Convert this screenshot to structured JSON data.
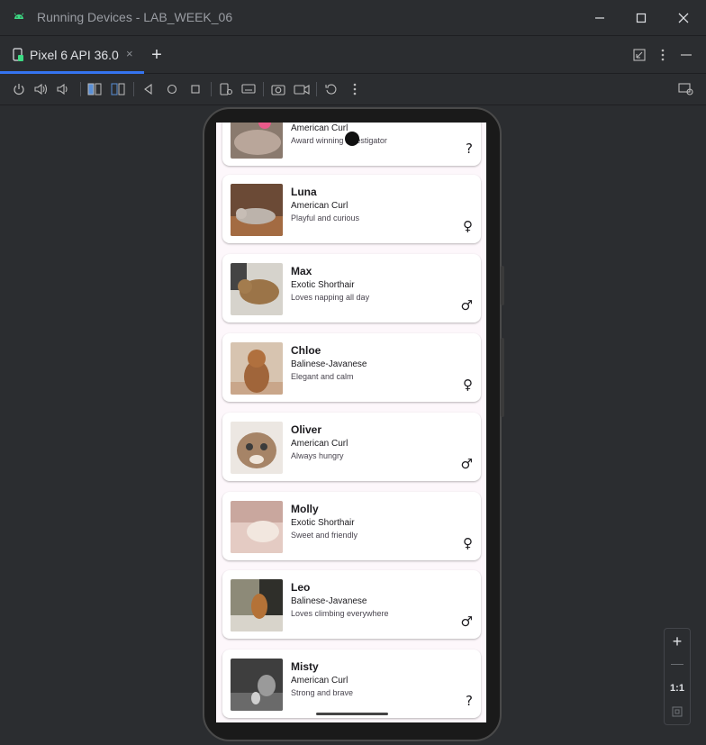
{
  "window": {
    "title": "Running Devices - LAB_WEEK_06"
  },
  "tab": {
    "label": "Pixel 6 API 36.0",
    "close": "×",
    "add": "+"
  },
  "zoom": {
    "plus": "+",
    "minus": "—",
    "one_to_one": "1:1"
  },
  "cats": [
    {
      "name": "",
      "breed": "American Curl",
      "desc": "Award winning investigator",
      "gender": "?"
    },
    {
      "name": "Luna",
      "breed": "American Curl",
      "desc": "Playful and curious",
      "gender": "♀"
    },
    {
      "name": "Max",
      "breed": "Exotic Shorthair",
      "desc": "Loves napping all day",
      "gender": "♂"
    },
    {
      "name": "Chloe",
      "breed": "Balinese-Javanese",
      "desc": "Elegant and calm",
      "gender": "♀"
    },
    {
      "name": "Oliver",
      "breed": "American Curl",
      "desc": "Always hungry",
      "gender": "♂"
    },
    {
      "name": "Molly",
      "breed": "Exotic Shorthair",
      "desc": "Sweet and friendly",
      "gender": "♀"
    },
    {
      "name": "Leo",
      "breed": "Balinese-Javanese",
      "desc": "Loves climbing everywhere",
      "gender": "♂"
    },
    {
      "name": "Misty",
      "breed": "American Curl",
      "desc": "Strong and brave",
      "gender": "?"
    }
  ]
}
